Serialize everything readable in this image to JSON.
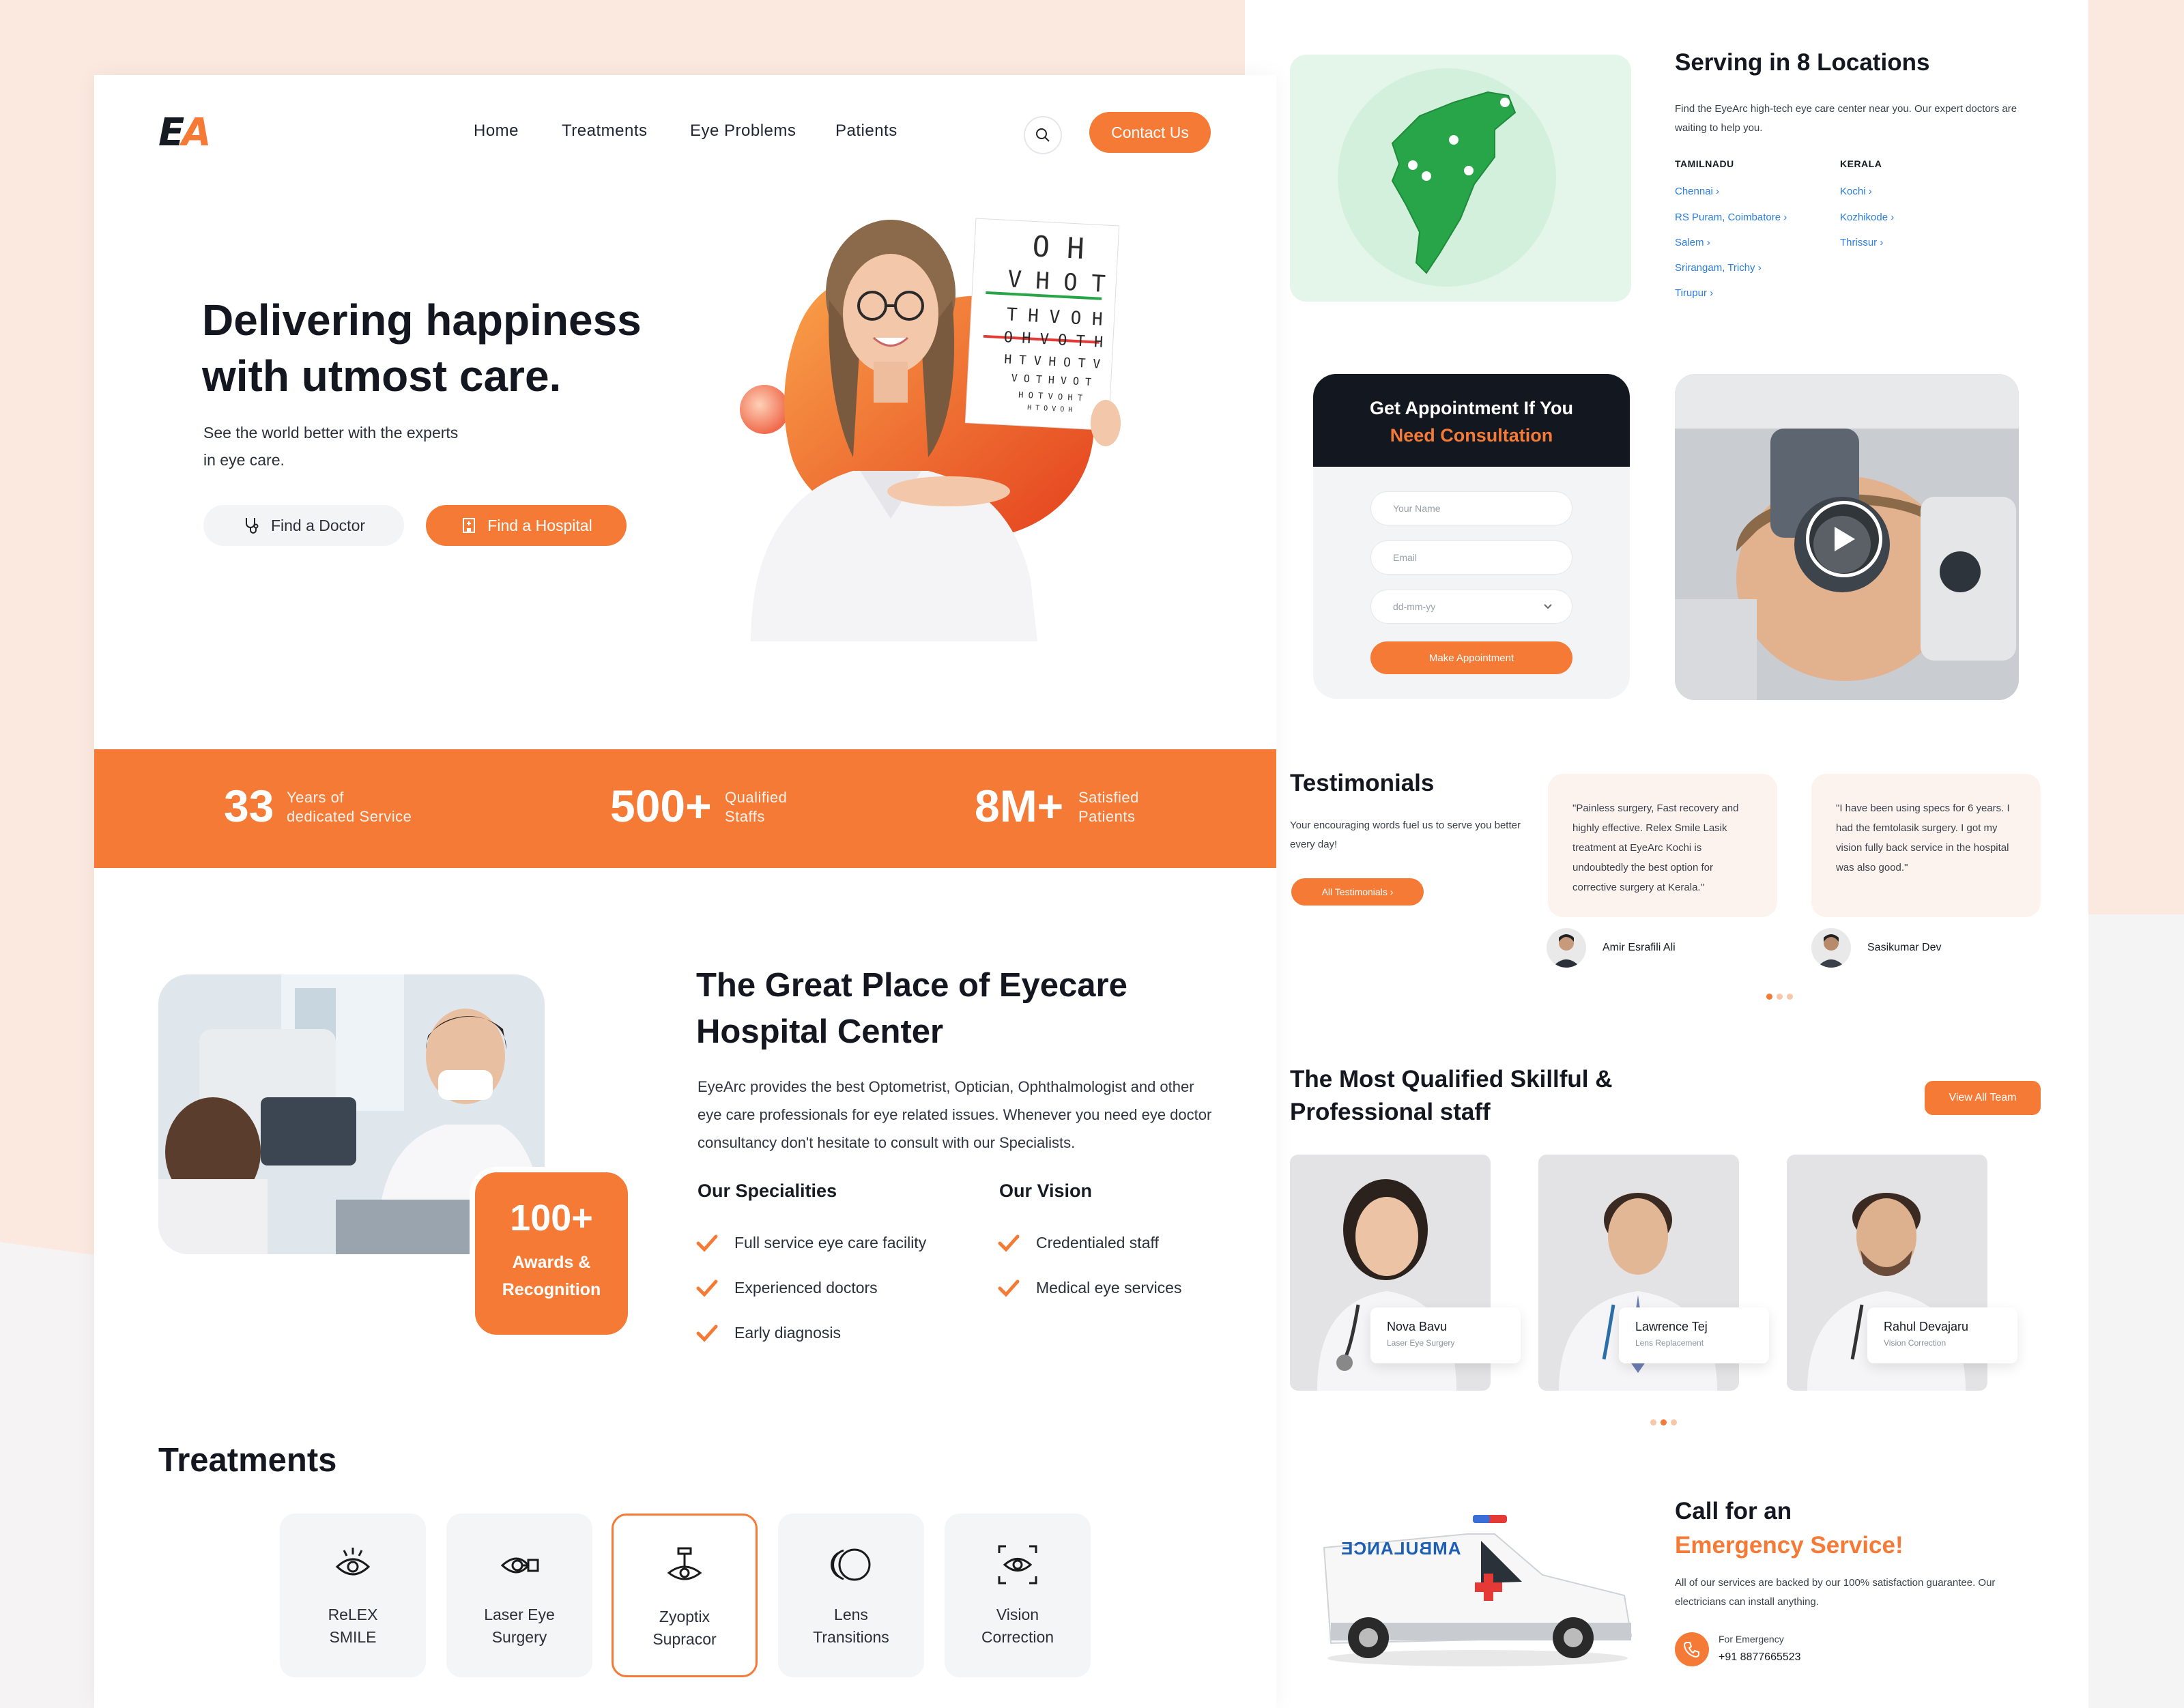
{
  "brand": {
    "logo_a": "E",
    "logo_b": "A"
  },
  "nav": {
    "items": [
      "Home",
      "Treatments",
      "Eye Problems",
      "Patients"
    ],
    "contact": "Contact Us"
  },
  "hero": {
    "title": "Delivering happiness\nwith utmost care.",
    "subtitle": "See the world better with the experts\nin eye care.",
    "btn_doctor": "Find a Doctor",
    "btn_hospital": "Find a Hospital",
    "eye_chart": [
      "O H",
      "V H O T",
      "T H V O H",
      "O H V O T H",
      "H T V H O T V",
      "V O T H V O T",
      "H O T V O H T",
      "H T O V O H"
    ]
  },
  "stats": [
    {
      "num": "33",
      "label": "Years of\ndedicated Service"
    },
    {
      "num": "500+",
      "label": "Qualified\nStaffs"
    },
    {
      "num": "8M+",
      "label": "Satisfied\nPatients"
    }
  ],
  "about": {
    "title": "The Great Place of Eyecare\nHospital Center",
    "body": "EyeArc provides the best Optometrist, Optician, Ophthalmologist and other eye care professionals for eye related issues. Whenever you need eye doctor consultancy don't hesitate to consult with our Specialists.",
    "awards_num": "100+",
    "awards_label": "Awards &\nRecognition",
    "specialities_head": "Our Specialities",
    "specialities": [
      "Full service eye care facility",
      "Experienced doctors",
      "Early diagnosis"
    ],
    "vision_head": "Our Vision",
    "vision": [
      "Credentialed staff",
      "Medical eye services"
    ]
  },
  "treatments": {
    "title": "Treatments",
    "items": [
      {
        "label": "ReLEX\nSMILE",
        "icon": "eye-lash-icon"
      },
      {
        "label": "Laser Eye\nSurgery",
        "icon": "laser-eye-icon"
      },
      {
        "label": "Zyoptix\nSupracor",
        "icon": "eye-laser-beam-icon"
      },
      {
        "label": "Lens\nTransitions",
        "icon": "lens-icon"
      },
      {
        "label": "Vision\nCorrection",
        "icon": "eye-focus-icon"
      }
    ]
  },
  "locations": {
    "title": "Serving in 8 Locations",
    "subtitle": "Find the EyeArc high-tech eye care center near you. Our expert doctors are waiting to help you.",
    "tamil_head": "TAMILNADU",
    "tamil": [
      "Chennai",
      "RS Puram, Coimbatore",
      "Salem",
      "Srirangam, Trichy",
      "Tirupur"
    ],
    "kerala_head": "KERALA",
    "kerala": [
      "Kochi",
      "Kozhikode",
      "Thrissur"
    ]
  },
  "appointment": {
    "title1": "Get Appointment If You",
    "title2": "Need Consultation",
    "name_ph": "Your Name",
    "email_ph": "Email",
    "date_ph": "dd-mm-yy",
    "button": "Make Appointment"
  },
  "testimonials": {
    "title": "Testimonials",
    "subtitle": "Your encouraging words fuel us to serve you better every day!",
    "button": "All Testimonials",
    "items": [
      {
        "quote": "\"Painless surgery, Fast recovery and highly effective. Relex Smile Lasik treatment at EyeArc Kochi is undoubtedly the best option for corrective surgery at Kerala.\"",
        "name": "Amir Esrafili Ali"
      },
      {
        "quote": "\"I have been using specs for 6 years. I had the femtolasik surgery. I got my vision fully back service in the hospital was also good.\"",
        "name": "Sasikumar Dev"
      }
    ]
  },
  "staff": {
    "title": "The Most Qualified Skillful &\nProfessional staff",
    "button": "View All Team",
    "items": [
      {
        "name": "Nova Bavu",
        "spec": "Laser Eye Surgery"
      },
      {
        "name": "Lawrence Tej",
        "spec": "Lens Replacement"
      },
      {
        "name": "Rahul Devajaru",
        "spec": "Vision Correction"
      }
    ]
  },
  "emergency": {
    "title1": "Call for an",
    "title2": "Emergency Service!",
    "subtitle": "All of our services are backed by our 100% satisfaction guarantee. Our electricians can install anything.",
    "label": "For Emergency",
    "phone": "+91 8877665523",
    "ambulance_text": "AMBULANCE"
  },
  "colors": {
    "accent": "#f47a36",
    "dark": "#121720",
    "map_green": "#27a548",
    "link": "#2a7de1"
  }
}
